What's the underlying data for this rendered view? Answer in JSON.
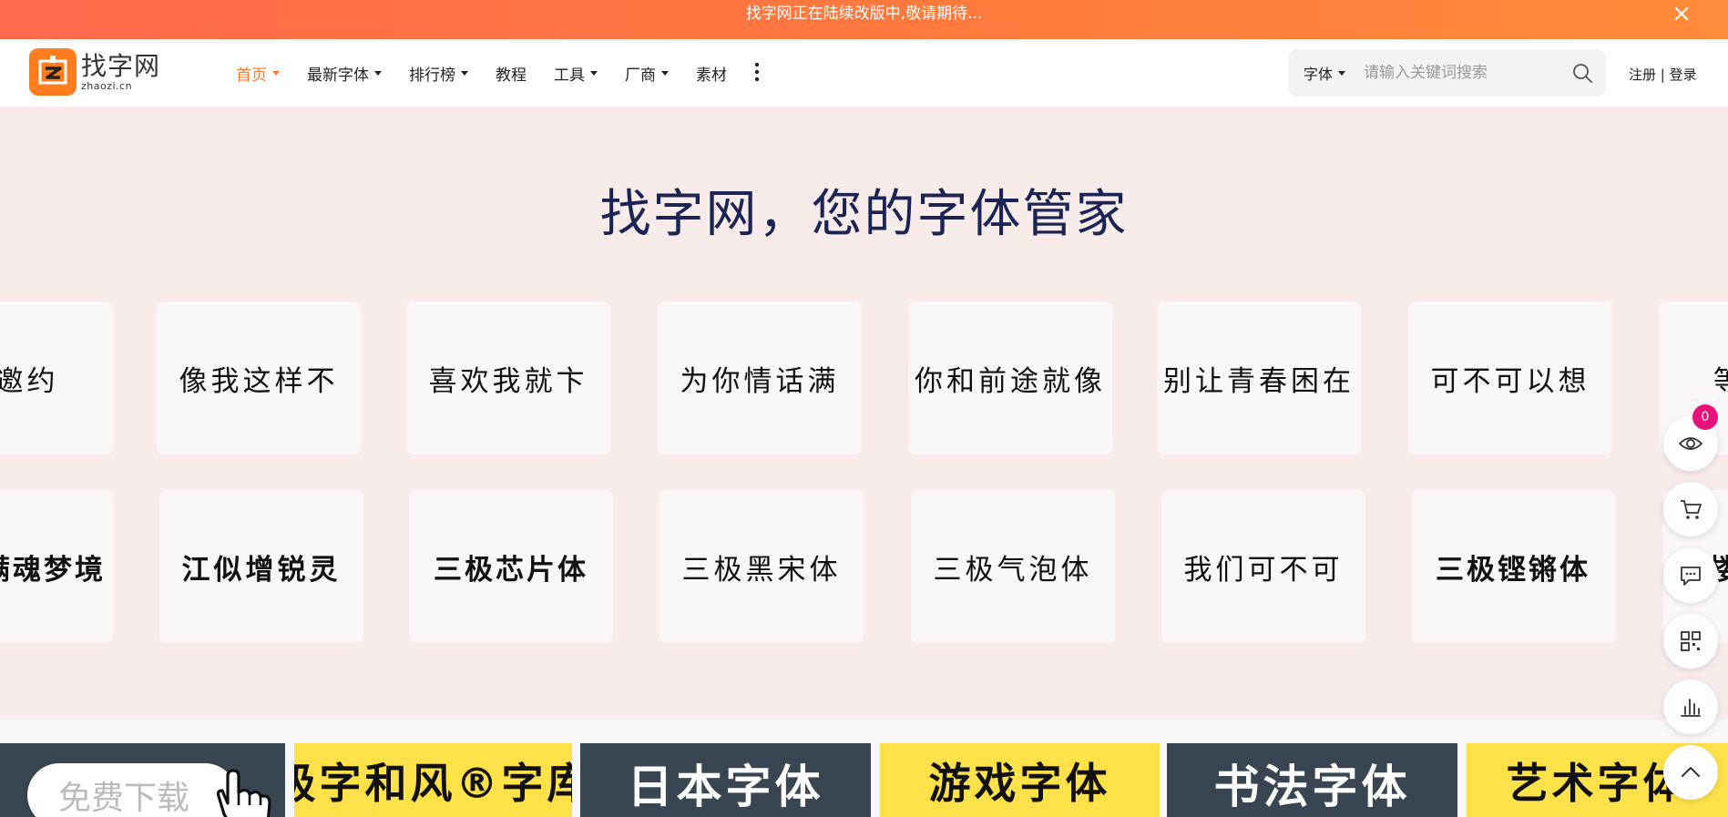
{
  "announcement": {
    "text": "找字网正在陆续改版中,敬请期待...",
    "close_icon": "close-icon"
  },
  "header": {
    "logo_cn": "找字网",
    "logo_en": "zhaozi.cn",
    "nav": [
      {
        "label": "首页",
        "dropdown": true,
        "active": true
      },
      {
        "label": "最新字体",
        "dropdown": true
      },
      {
        "label": "排行榜",
        "dropdown": true
      },
      {
        "label": "教程",
        "dropdown": false
      },
      {
        "label": "工具",
        "dropdown": true
      },
      {
        "label": "厂商",
        "dropdown": true
      },
      {
        "label": "素材",
        "dropdown": false
      }
    ],
    "search": {
      "type_label": "字体",
      "placeholder": "请输入关键词搜索"
    },
    "register": "注册",
    "separator": "|",
    "login": "登录"
  },
  "hero": {
    "title": "找字网，您的字体管家",
    "row1": [
      "的邀约",
      "像我这样不",
      "喜欢我就卞",
      "为你情话满",
      "你和前途就像",
      "别让青春困在",
      "可不可以想",
      "等你"
    ],
    "row2": [
      "心满魂梦境",
      "江似增锐灵",
      "三极芯片体",
      "三极黑宋体",
      "三极气泡体",
      "我们可不可",
      "三极铿锵体",
      "楼"
    ]
  },
  "banner": {
    "free_download": "免费下载",
    "tiles": [
      "极字和风®字库",
      "日本字体",
      "游戏字体",
      "书法字体",
      "艺术字体"
    ]
  },
  "floating": {
    "cart_count": "0"
  },
  "colors": {
    "accent": "#ff7a2b",
    "hero_bg": "#f8eceb",
    "title": "#1c2456",
    "badge": "#e8127a"
  }
}
